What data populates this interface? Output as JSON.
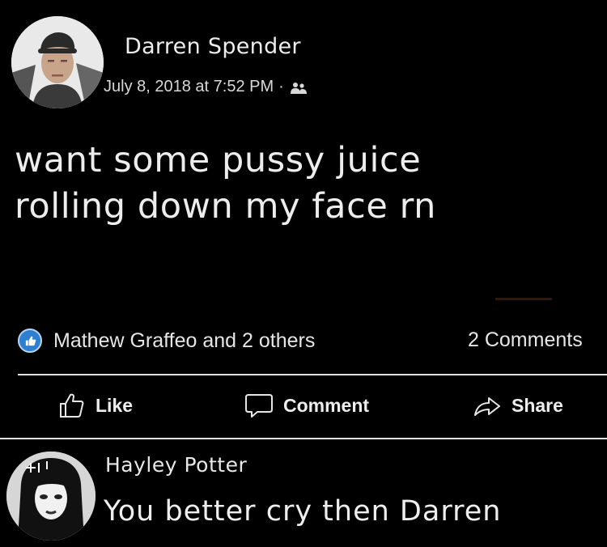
{
  "post": {
    "author": "Darren Spender",
    "timestamp": "July 8, 2018 at 7:52 PM",
    "separator": "·",
    "audience_icon": "friends-icon",
    "body_line1": "want some pussy juice",
    "body_line2": "rolling down my face rn"
  },
  "reactions": {
    "summary": "Mathew Graffeo and 2 others",
    "comments_count": "2 Comments",
    "badge_icon": "thumbs-up-icon",
    "badge_color": "#2d7fd1"
  },
  "actions": {
    "like_label": "Like",
    "comment_label": "Comment",
    "share_label": "Share"
  },
  "comment": {
    "author": "Hayley Potter",
    "text": "You better cry then Darren"
  },
  "colors": {
    "background": "#000000",
    "text": "#ececec",
    "divider": "#e2e2e2"
  }
}
